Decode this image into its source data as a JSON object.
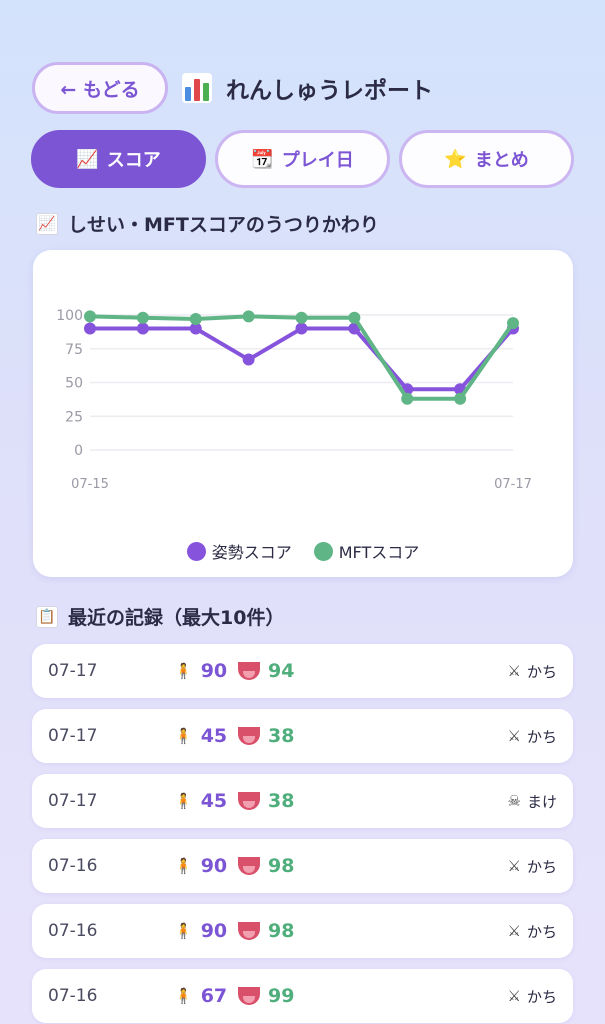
{
  "header": {
    "back_label": "← もどる",
    "title": "れんしゅうレポート",
    "title_icon": "bar-chart-icon"
  },
  "tabs": [
    {
      "icon": "📈",
      "label": "スコア",
      "active": true
    },
    {
      "icon": "📆",
      "label": "プレイ日",
      "active": false
    },
    {
      "icon": "⭐",
      "label": "まとめ",
      "active": false
    }
  ],
  "chart_section": {
    "icon": "📈",
    "title": "しせい・MFTスコアのうつりかわり"
  },
  "chart_data": {
    "type": "line",
    "x_tick_labels": [
      "07-15",
      "07-17"
    ],
    "ylim": [
      0,
      100
    ],
    "y_ticks": [
      0,
      25,
      50,
      75,
      100
    ],
    "grid": true,
    "legend_position": "bottom",
    "series": [
      {
        "name": "姿勢スコア",
        "color": "#8654dc",
        "values": [
          90,
          90,
          90,
          67,
          90,
          90,
          45,
          45,
          90
        ]
      },
      {
        "name": "MFTスコア",
        "color": "#5fb585",
        "values": [
          99,
          98,
          97,
          99,
          98,
          98,
          38,
          38,
          94
        ]
      }
    ]
  },
  "records_section": {
    "icon": "📋",
    "title": "最近の記録（最大10件）"
  },
  "records": [
    {
      "date": "07-17",
      "posture": "90",
      "mft": "94",
      "result_icon": "crossed-swords-icon",
      "result": "かち"
    },
    {
      "date": "07-17",
      "posture": "45",
      "mft": "38",
      "result_icon": "crossed-swords-icon",
      "result": "かち"
    },
    {
      "date": "07-17",
      "posture": "45",
      "mft": "38",
      "result_icon": "skull-icon",
      "result": "まけ"
    },
    {
      "date": "07-16",
      "posture": "90",
      "mft": "98",
      "result_icon": "crossed-swords-icon",
      "result": "かち"
    },
    {
      "date": "07-16",
      "posture": "90",
      "mft": "98",
      "result_icon": "crossed-swords-icon",
      "result": "かち"
    },
    {
      "date": "07-16",
      "posture": "67",
      "mft": "99",
      "result_icon": "crossed-swords-icon",
      "result": "かち"
    }
  ]
}
